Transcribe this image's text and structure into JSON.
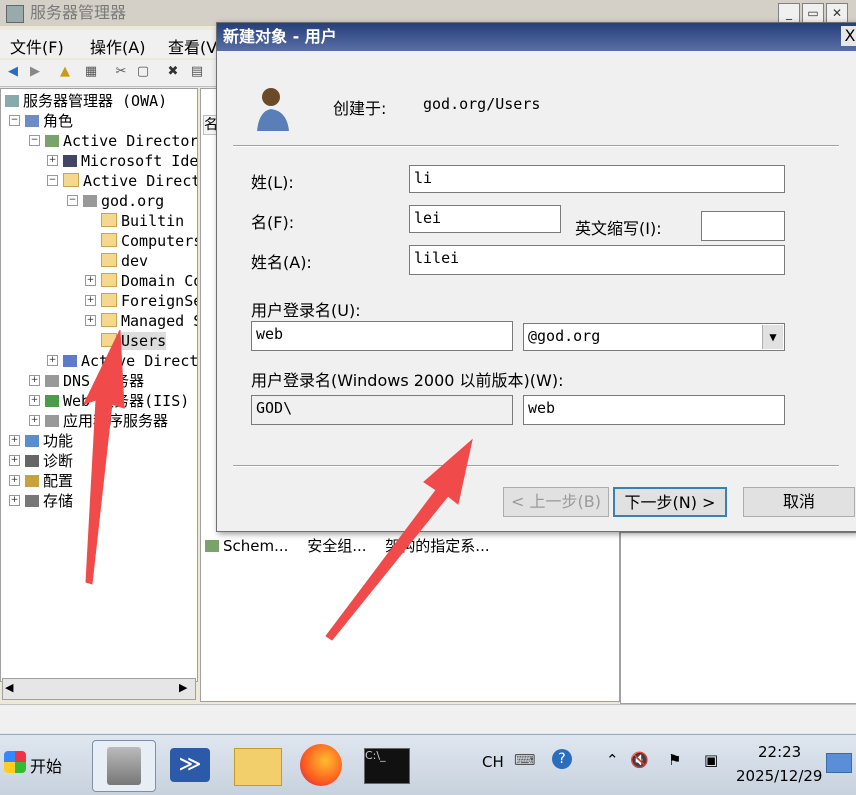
{
  "main_window": {
    "title": "服务器管理器",
    "menu": [
      "文件(F)",
      "操作(A)",
      "查看(V)"
    ],
    "controls": [
      "_",
      "▭",
      "✕"
    ]
  },
  "tree": {
    "items": [
      {
        "label": "服务器管理器 (OWA)"
      },
      {
        "label": "角色"
      },
      {
        "label": "Active Directory 域服务"
      },
      {
        "label": "Microsoft Identity"
      },
      {
        "label": "Active Directory 用户和计算机"
      },
      {
        "label": "god.org"
      },
      {
        "label": "Builtin"
      },
      {
        "label": "Computers"
      },
      {
        "label": "dev"
      },
      {
        "label": "Domain Controllers"
      },
      {
        "label": "ForeignSecurityPrincipals"
      },
      {
        "label": "Managed Service Accounts"
      },
      {
        "label": "Users"
      },
      {
        "label": "Active Directory 站点和服务"
      },
      {
        "label": "DNS 服务器"
      },
      {
        "label": "Web 服务器(IIS)"
      },
      {
        "label": "应用程序服务器"
      },
      {
        "label": "功能"
      },
      {
        "label": "诊断"
      },
      {
        "label": "配置"
      },
      {
        "label": "存储"
      }
    ]
  },
  "list": {
    "header": "名",
    "visible_row": {
      "name": "Schem...",
      "type": "安全组...",
      "desc": "架构的指定系..."
    }
  },
  "dialog": {
    "title": "新建对象 - 用户",
    "created_in_label": "创建于:",
    "created_in_value": "god.org/Users",
    "last_name_label": "姓(L):",
    "last_name_value": "li",
    "first_name_label": "名(F):",
    "first_name_value": "lei",
    "initials_label": "英文缩写(I):",
    "initials_value": "",
    "full_name_label": "姓名(A):",
    "full_name_value": "lilei",
    "logon_label": "用户登录名(U):",
    "logon_value": "web",
    "domain_value": "@god.org",
    "pre2000_label": "用户登录名(Windows 2000 以前版本)(W):",
    "pre2000_domain": "GOD\\",
    "pre2000_value": "web",
    "back_button": "< 上一步(B)",
    "next_button": "下一步(N) >",
    "cancel_button": "取消",
    "close": "X"
  },
  "taskbar": {
    "start_label": "开始",
    "lang": "CH",
    "time": "22:23",
    "date": "2025/12/29"
  },
  "colors": {
    "dialog_title_bg": "#253f7a",
    "arrow": "#f04a4a"
  }
}
